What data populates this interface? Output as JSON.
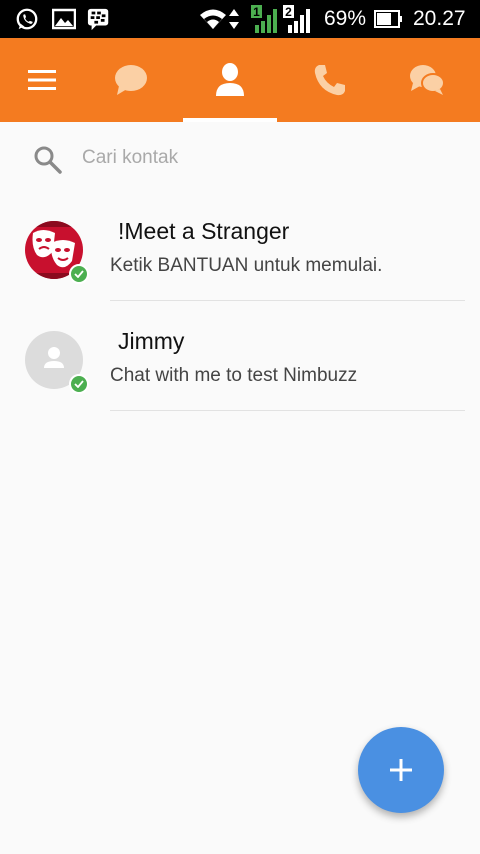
{
  "status_bar": {
    "battery_percent": "69%",
    "time": "20.27",
    "sim1_label": "1",
    "sim2_label": "2",
    "icons": [
      "whatsapp-icon",
      "gallery-icon",
      "blackberry-messenger-icon",
      "wifi-icon",
      "data-arrows-icon",
      "signal-sim1-icon",
      "signal-sim2-icon",
      "battery-icon"
    ]
  },
  "toolbar": {
    "color": "#f47b20",
    "items": [
      {
        "name": "menu",
        "icon": "menu-icon"
      },
      {
        "name": "chats",
        "icon": "chat-bubble-icon"
      },
      {
        "name": "contacts",
        "icon": "person-icon",
        "active": true
      },
      {
        "name": "calls",
        "icon": "phone-icon"
      },
      {
        "name": "groups",
        "icon": "group-chat-icon"
      }
    ]
  },
  "search": {
    "placeholder": "Cari kontak",
    "icon": "search-icon"
  },
  "contacts": [
    {
      "name": "!Meet a Stranger",
      "message": "Ketik BANTUAN untuk memulai.",
      "avatar": "theater-masks-avatar",
      "online": true
    },
    {
      "name": "Jimmy",
      "message": "Chat with me to test Nimbuzz",
      "avatar": "default-person-avatar",
      "online": true
    }
  ],
  "fab": {
    "icon": "plus-icon",
    "color": "#4a90e2"
  },
  "colors": {
    "online": "#4caf50",
    "accent": "#f47b20"
  }
}
